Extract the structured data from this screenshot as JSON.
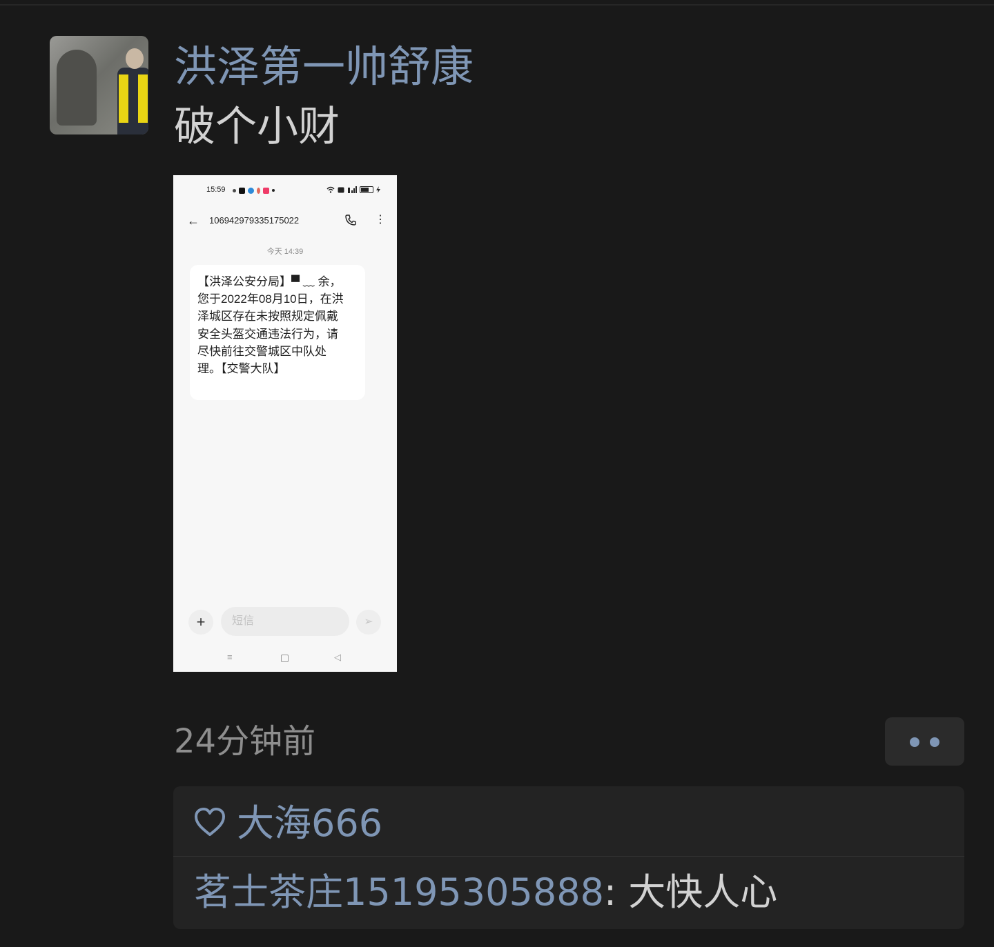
{
  "post": {
    "author": "洪泽第一帅舒康",
    "text": "破个小财",
    "time": "24分钟前"
  },
  "screenshot": {
    "status_time": "15:59",
    "sender_number": "106942979335175022",
    "date": "今天 14:39",
    "message": "【洪泽公安分局】▀ ﹏ 余，您于2022年08月10日，在洪泽城区存在未按照规定佩戴安全头盔交通违法行为，请尽快前往交警城区中队处理。【交警大队】",
    "input_placeholder": "短信",
    "plus_label": "+",
    "send_label": "➢",
    "nav_menu": "≡",
    "nav_back": "◁"
  },
  "likes": {
    "names": "大海666"
  },
  "comments": [
    {
      "author": "茗士茶庄15195305888",
      "sep": ": ",
      "text": "大快人心"
    }
  ],
  "colors": {
    "background": "#191919",
    "link_blue": "#7f96b5",
    "text_light": "#d2d2d2",
    "meta_gray": "#8e8e8e",
    "panel": "#232323"
  },
  "icons": {
    "like": "heart-icon",
    "more": "more-dots-icon",
    "back": "arrow-left-icon",
    "call": "phone-icon"
  }
}
